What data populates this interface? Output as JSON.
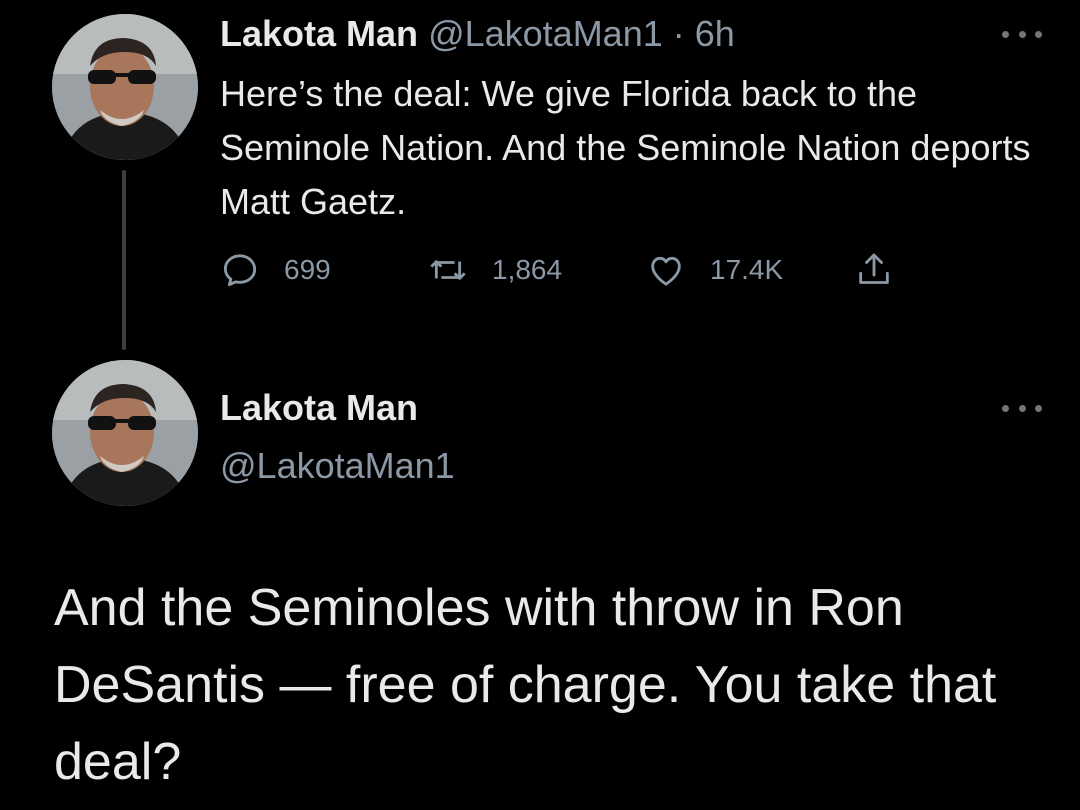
{
  "tweet1": {
    "display_name": "Lakota Man",
    "handle": "@LakotaMan1",
    "separator": "·",
    "time": "6h",
    "text": "Here’s the deal: We give Florida back to the Seminole Nation. And the Seminole Nation deports Matt Gaetz.",
    "actions": {
      "replies": "699",
      "retweets": "1,864",
      "likes": "17.4K"
    },
    "more_icon": "more-horizontal-icon"
  },
  "tweet2": {
    "display_name": "Lakota Man",
    "handle": "@LakotaMan1",
    "text": "And the Seminoles with throw in Ron DeSantis — free of charge. You take that deal?",
    "more_icon": "more-horizontal-icon"
  },
  "icons": {
    "reply": "reply-icon",
    "retweet": "retweet-icon",
    "like": "heart-icon",
    "share": "share-icon"
  },
  "colors": {
    "background": "#000000",
    "primary_text": "#e7e9ea",
    "secondary_text": "#8b98a5",
    "thread_line": "#3a3d41"
  }
}
